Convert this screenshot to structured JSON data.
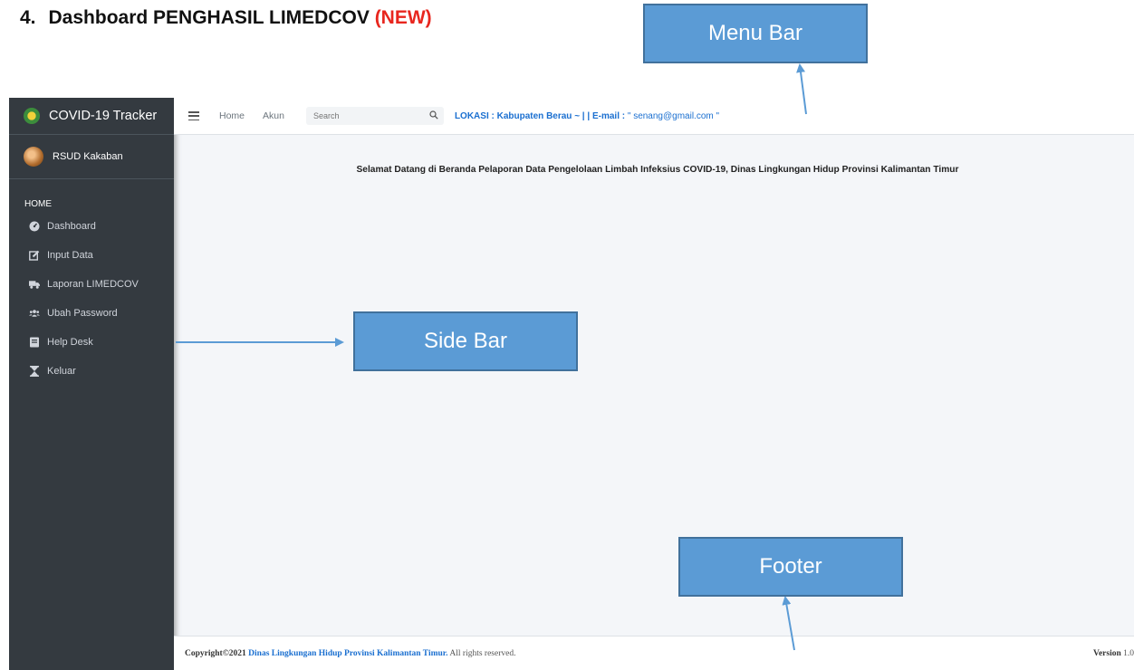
{
  "document": {
    "heading_number": "4.",
    "heading_text": "Dashboard PENGHASIL LIMEDCOV",
    "heading_tag": "(NEW)"
  },
  "callouts": {
    "menu_bar": "Menu Bar",
    "side_bar": "Side Bar",
    "footer": "Footer"
  },
  "app": {
    "brand": "COVID-19 Tracker",
    "user": "RSUD Kakaban",
    "nav_header": "HOME",
    "nav_items": [
      {
        "label": "Dashboard",
        "icon": "tachometer-icon"
      },
      {
        "label": "Input Data",
        "icon": "edit-icon"
      },
      {
        "label": "Laporan LIMEDCOV",
        "icon": "truck-icon"
      },
      {
        "label": "Ubah Password",
        "icon": "users-icon"
      },
      {
        "label": "Help Desk",
        "icon": "book-icon"
      },
      {
        "label": "Keluar",
        "icon": "hourglass-icon"
      }
    ],
    "topbar": {
      "home": "Home",
      "akun": "Akun",
      "search_placeholder": "Search",
      "lokasi_label": "LOKASI : Kabupaten Berau ~ | | E-mail : ",
      "email": "\" senang@gmail.com \""
    },
    "welcome": "Selamat Datang di Beranda Pelaporan Data Pengelolaan Limbah Infeksius COVID-19, Dinas Lingkungan Hidup Provinsi Kalimantan Timur",
    "footer": {
      "copyright": "Copyright©2021",
      "org": "Dinas Lingkungan Hidup Provinsi Kalimantan Timur.",
      "rights": "All rights reserved.",
      "version_label": "Version",
      "version_number": "1.0"
    }
  },
  "colors": {
    "sidebar_bg": "#343a40",
    "content_bg": "#f4f6f9",
    "link_blue": "#1a6fd0",
    "callout_fill": "#5b9bd5",
    "tag_red": "#e8261e"
  }
}
